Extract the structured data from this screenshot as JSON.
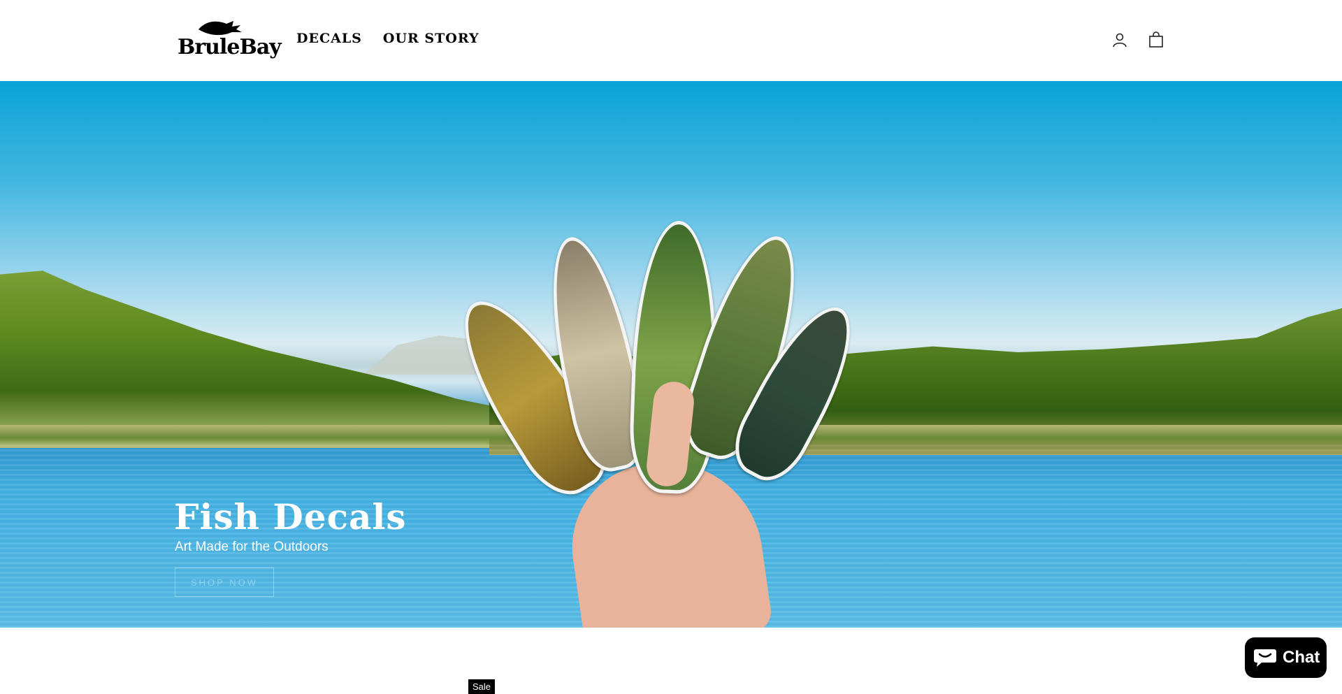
{
  "header": {
    "logo_text": "BruleBay",
    "nav": [
      "DECALS",
      "OUR STORY"
    ],
    "icons": [
      "account-icon",
      "cart-icon"
    ]
  },
  "hero": {
    "title": "Fish Decals",
    "subtitle": "Art Made for the Outdoors",
    "cta_label": "SHOP NOW"
  },
  "product": {
    "badge": "Sale"
  },
  "chat": {
    "label": "Chat",
    "icon": "chat-bubble-icon"
  }
}
